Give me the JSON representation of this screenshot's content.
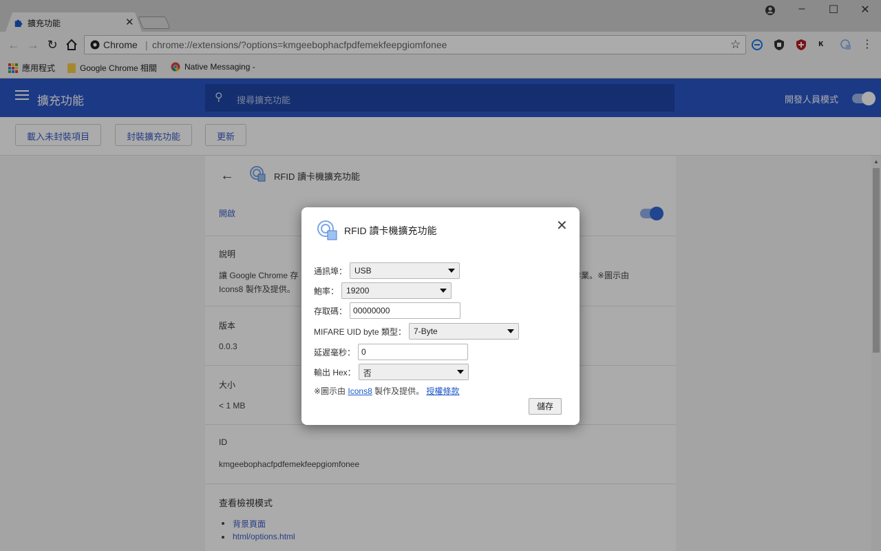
{
  "browser": {
    "tab_title": "擴充功能",
    "tab_close": "✕",
    "omnibox_label": "Chrome",
    "omnibox_sep": "|",
    "url": "chrome://extensions/?options=kmgeebophacfpdfemekfeepgiomfonee",
    "bookmarks": {
      "apps": "應用程式",
      "item1": "Google Chrome 相關",
      "item2": "Native Messaging -"
    }
  },
  "page": {
    "title": "擴充功能",
    "search_placeholder": "搜尋擴充功能",
    "dev_mode_label": "開發人員模式",
    "dev_mode_on": true,
    "actions": {
      "load_unpacked": "載入未封裝項目",
      "pack": "封裝擴充功能",
      "update": "更新"
    },
    "detail": {
      "name": "RFID 讀卡機擴充功能",
      "enabled_label": "開啟",
      "enabled": true,
      "description_label": "說明",
      "description_left": "讓 Google Chrome 存",
      "description_right": "作業。※圖示由",
      "description_line2": "Icons8 製作及提供。",
      "version_label": "版本",
      "version": "0.0.3",
      "size_label": "大小",
      "size": "< 1 MB",
      "id_label": "ID",
      "id": "kmgeebophacfpdfemekfeepgiomfonee",
      "views_label": "查看檢視模式",
      "views": [
        "背景頁面",
        "html/options.html"
      ]
    }
  },
  "dialog": {
    "title": "RFID 讀卡機擴充功能",
    "fields": {
      "port_label": "通訊埠：",
      "port_value": "USB",
      "baud_label": "鮑率：",
      "baud_value": "19200",
      "access_label": "存取碼：",
      "access_value": "00000000",
      "uid_label": "MIFARE UID byte 類型：",
      "uid_value": "7-Byte",
      "delay_label": "延遲毫秒：",
      "delay_value": "0",
      "hex_label": "輸出 Hex：",
      "hex_value": "否"
    },
    "note_prefix": "※圖示由",
    "note_link": "Icons8",
    "note_mid": "製作及提供。",
    "note_license": "授權條款",
    "save_label": "儲存"
  },
  "colors": {
    "appbar": "#2a56c6",
    "search_bg": "#1e45a8",
    "link": "#1a57c9",
    "toggle_knob": "#3367d6"
  }
}
